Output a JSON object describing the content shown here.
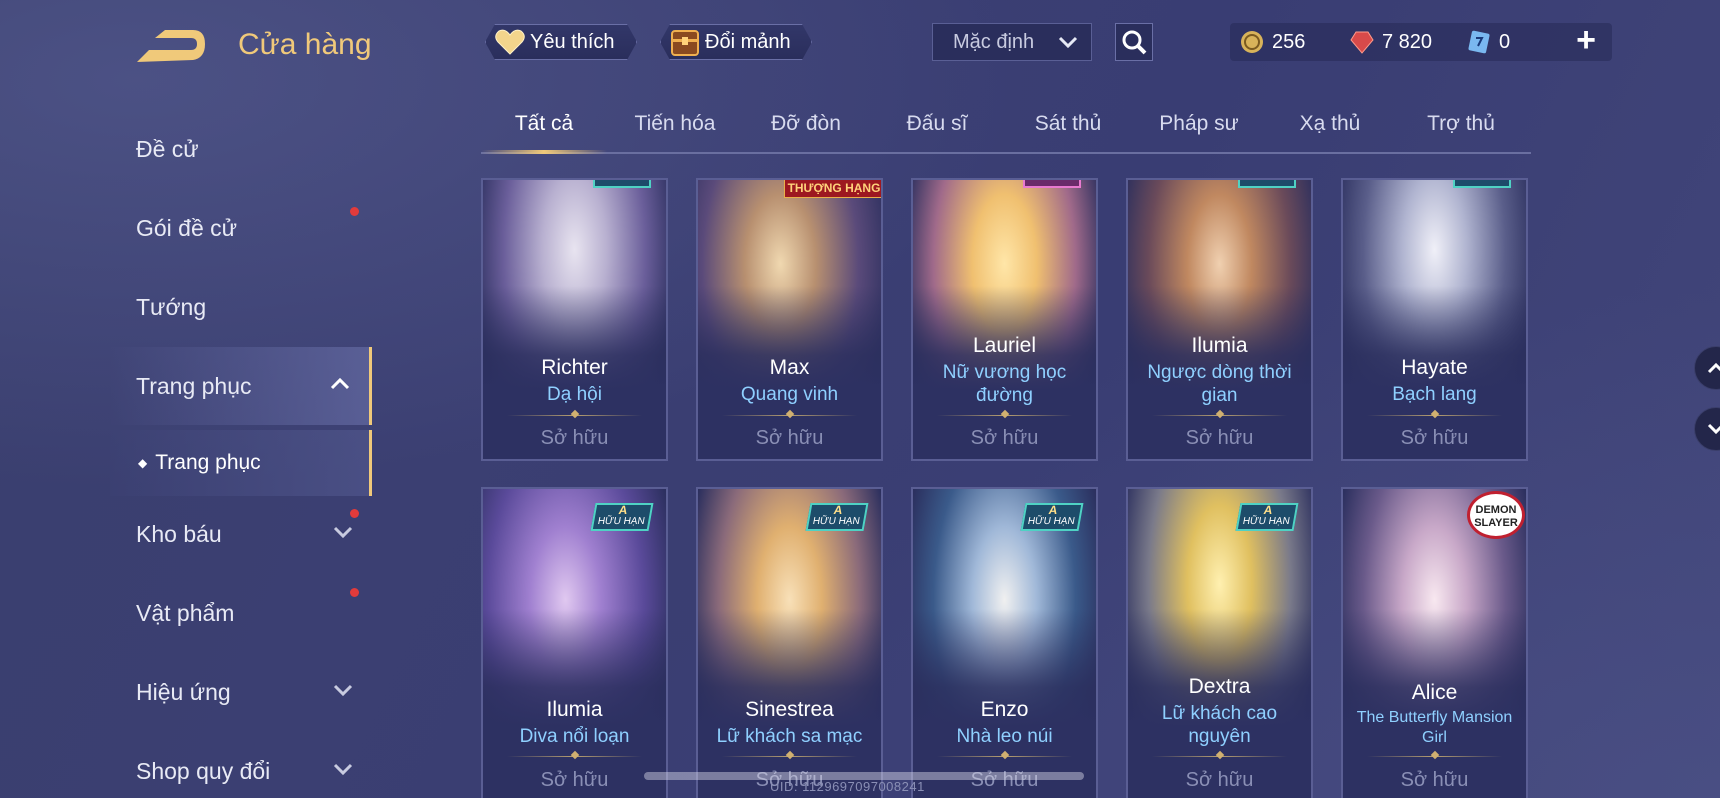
{
  "header": {
    "title": "Cửa hàng",
    "favorite_label": "Yêu thích",
    "exchange_label": "Đổi mảnh",
    "sort_value": "Mặc định",
    "gold": "256",
    "ruby": "7 820",
    "ticket": "0",
    "plus": "+"
  },
  "sidebar": {
    "items": [
      {
        "label": "Đề cử"
      },
      {
        "label": "Gói đề cử"
      },
      {
        "label": "Tướng"
      },
      {
        "label": "Trang phục"
      },
      {
        "label": "Trang phục"
      },
      {
        "label": "Kho báu"
      },
      {
        "label": "Vật phẩm"
      },
      {
        "label": "Hiệu ứng"
      },
      {
        "label": "Shop quy đổi"
      }
    ]
  },
  "tabs": [
    "Tất cả",
    "Tiến hóa",
    "Đỡ đòn",
    "Đấu sĩ",
    "Sát thủ",
    "Pháp sư",
    "Xạ thủ",
    "Trợ thủ"
  ],
  "tags": {
    "premium": "THƯỢNG HẠNG",
    "grade": "A",
    "limited": "HỮU HẠN",
    "collab": "DEMON SLAYER"
  },
  "cards": [
    {
      "hero": "Richter",
      "skin": "Dạ hội",
      "owned": "Sở hữu"
    },
    {
      "hero": "Max",
      "skin": "Quang vinh",
      "owned": "Sở hữu"
    },
    {
      "hero": "Lauriel",
      "skin": "Nữ vương học đường",
      "owned": "Sở hữu"
    },
    {
      "hero": "Ilumia",
      "skin": "Ngược dòng thời gian",
      "owned": "Sở hữu"
    },
    {
      "hero": "Hayate",
      "skin": "Bạch lang",
      "owned": "Sở hữu"
    },
    {
      "hero": "Ilumia",
      "skin": "Diva nổi loạn",
      "owned": "Sở hữu"
    },
    {
      "hero": "Sinestrea",
      "skin": "Lữ khách sa mạc",
      "owned": "Sở hữu"
    },
    {
      "hero": "Enzo",
      "skin": "Nhà leo núi",
      "owned": "Sở hữu"
    },
    {
      "hero": "Dextra",
      "skin": "Lữ khách cao nguyên",
      "owned": "Sở hữu"
    },
    {
      "hero": "Alice",
      "skin": "The Butterfly Mansion Girl",
      "owned": "Sở hữu"
    }
  ],
  "footer": {
    "uid": "UID: 1129697097008241"
  },
  "colors": {
    "accent": "#f0c97a",
    "skin_text": "#8fd0ff",
    "notification": "#e23b3b",
    "background": "#3a3f6e"
  }
}
